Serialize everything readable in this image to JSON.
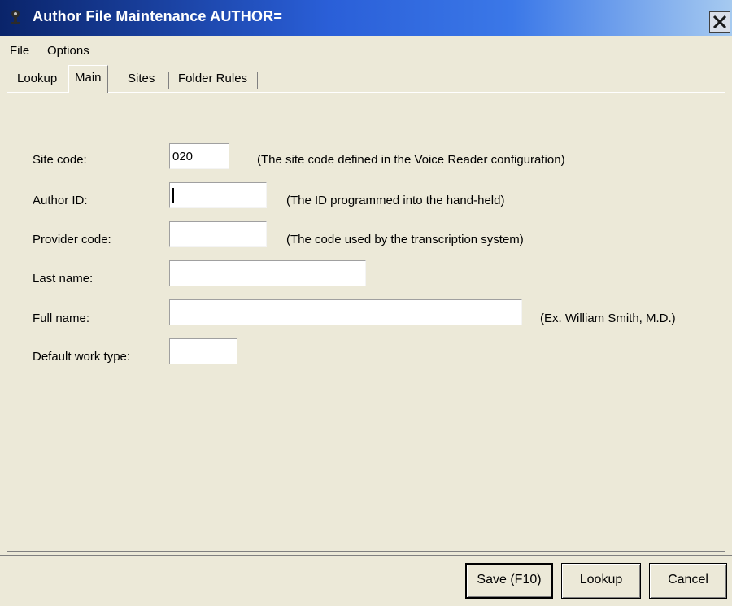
{
  "window": {
    "title": "Author File Maintenance    AUTHOR=",
    "close_icon": "close-icon"
  },
  "menu": {
    "items": [
      "File",
      "Options"
    ]
  },
  "tabs": [
    {
      "label": "Lookup",
      "active": false
    },
    {
      "label": "Main",
      "active": true
    },
    {
      "label": "Sites",
      "active": false
    },
    {
      "label": "Folder Rules",
      "active": false
    }
  ],
  "form": {
    "site_code": {
      "label": "Site code:",
      "value": "020",
      "hint": "(The site code defined in the Voice Reader configuration)"
    },
    "author_id": {
      "label": "Author ID:",
      "value": "",
      "hint": "(The ID programmed into the hand-held)"
    },
    "provider_code": {
      "label": "Provider code:",
      "value": "",
      "hint": "(The code used by the transcription system)"
    },
    "last_name": {
      "label": "Last name:",
      "value": ""
    },
    "full_name": {
      "label": "Full name:",
      "value": "",
      "hint": "(Ex. William Smith, M.D.)"
    },
    "default_work_type": {
      "label": "Default work type:",
      "value": ""
    }
  },
  "buttons": {
    "save": "Save (F10)",
    "lookup": "Lookup",
    "cancel": "Cancel"
  },
  "colors": {
    "titlebar_start": "#0a246a",
    "titlebar_end": "#a6caf0",
    "face": "#ece9d8"
  }
}
